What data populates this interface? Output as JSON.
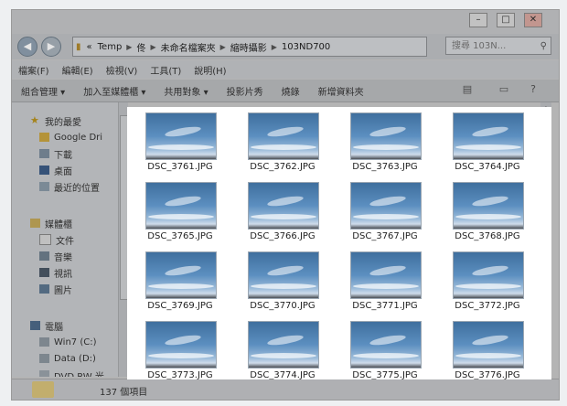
{
  "window": {
    "buttons": {
      "minimize": "–",
      "maximize": "□",
      "close": "✕"
    }
  },
  "address": {
    "segments": [
      "«",
      "Temp",
      "佟",
      "未命名檔案夾",
      "縮時攝影",
      "103ND700"
    ],
    "search_placeholder": "搜尋 103N..."
  },
  "menu": [
    "檔案(F)",
    "編輯(E)",
    "檢視(V)",
    "工具(T)",
    "說明(H)"
  ],
  "commands": [
    "組合管理 ▾",
    "加入至媒體櫃 ▾",
    "共用對象 ▾",
    "投影片秀",
    "燒錄",
    "新增資料夾"
  ],
  "sidebar": {
    "favorites_header": "我的最愛",
    "favorites": [
      "Google Dri",
      "下載",
      "桌面",
      "最近的位置"
    ],
    "libraries_header": "媒體櫃",
    "libraries": [
      "文件",
      "音樂",
      "視訊",
      "圖片"
    ],
    "computer_header": "電腦",
    "computer": [
      "Win7 (C:)",
      "Data (D:)",
      "DVD RW 光"
    ]
  },
  "files": [
    "DSC_3761.JPG",
    "DSC_3762.JPG",
    "DSC_3763.JPG",
    "DSC_3764.JPG",
    "DSC_3765.JPG",
    "DSC_3766.JPG",
    "DSC_3767.JPG",
    "DSC_3768.JPG",
    "DSC_3769.JPG",
    "DSC_3770.JPG",
    "DSC_3771.JPG",
    "DSC_3772.JPG",
    "DSC_3773.JPG",
    "DSC_3774.JPG",
    "DSC_3775.JPG",
    "DSC_3776.JPG"
  ],
  "status": {
    "count": "137 個項目"
  }
}
